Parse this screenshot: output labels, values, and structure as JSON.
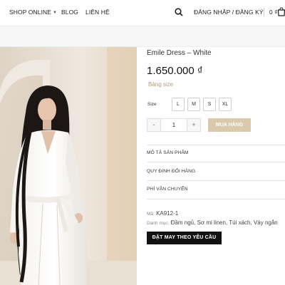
{
  "nav": {
    "shop_online": "SHOP ONLINE",
    "blog": "BLOG",
    "contact": "LIÊN HỆ",
    "account": "ĐĂNG NHẬP / ĐĂNG KÝ",
    "cart_count": "0 ₫"
  },
  "product": {
    "title": "Emile Dress – White",
    "price": "1.650.000 ₫",
    "size_guide": "Bảng size",
    "size_label": "Size",
    "sizes": [
      "L",
      "M",
      "S",
      "XL"
    ],
    "quantity": "1",
    "qty_minus": "-",
    "qty_plus": "+",
    "buy_label": "MUA HÀNG",
    "accordion": [
      "MÔ TẢ SẢN PHẨM",
      "QUY ĐỊNH ĐỔI HÀNG",
      "PHÍ VẬN CHUYỂN"
    ],
    "sku_label": "Mã:",
    "sku": "KA912-1",
    "category_label": "Danh mục:",
    "categories": "Đầm ngủ, Sơ mi linen, Túi xách, Váy ngắn",
    "custom_button": "ĐẶT MAY THEO YÊU CẦU"
  },
  "icons": {
    "search": "search-icon",
    "cart": "cart-icon",
    "chevron": "chevron-down-icon"
  },
  "colors": {
    "accent": "#d9c9ad",
    "size_guide": "#b09b6f",
    "dark_button": "#111111"
  }
}
